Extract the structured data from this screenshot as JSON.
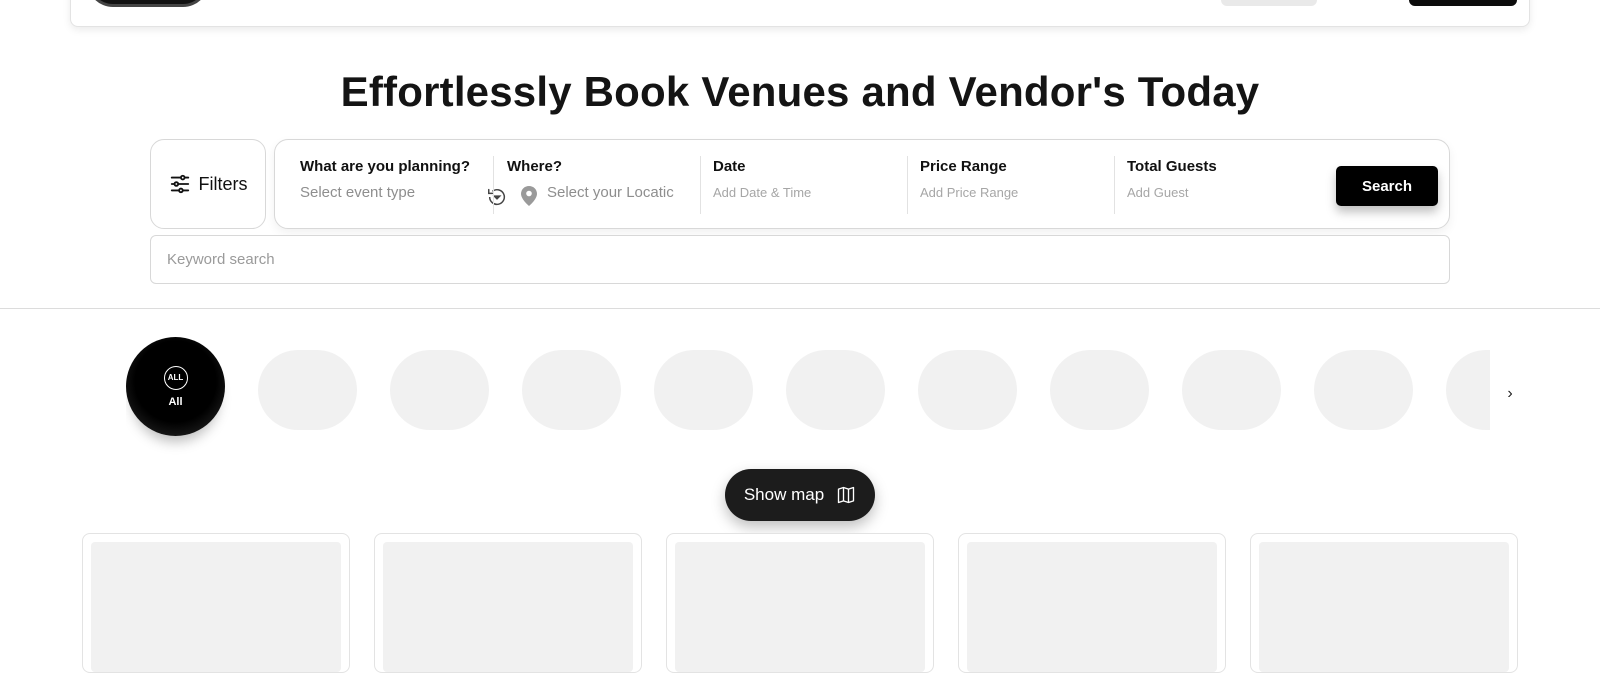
{
  "hero": {
    "title": "Effortlessly Book Venues and Vendor's Today"
  },
  "filters": {
    "label": "Filters"
  },
  "search": {
    "planning_label": "What are you planning?",
    "planning_placeholder": "Select event type",
    "where_label": "Where?",
    "where_placeholder": "Select your Locatic",
    "date_label": "Date",
    "date_placeholder": "Add Date & Time",
    "price_label": "Price Range",
    "price_placeholder": "Add Price Range",
    "guests_label": "Total Guests",
    "guests_placeholder": "Add Guest",
    "button": "Search"
  },
  "keyword": {
    "placeholder": "Keyword search"
  },
  "categories": {
    "all_badge": "ALL",
    "all_label": "All",
    "next": "›"
  },
  "map_button": {
    "label": "Show map"
  },
  "colors": {
    "accent": "#000000",
    "placeholder_bg": "#f1f1f1",
    "map_button_bg": "#1c1c1c"
  },
  "icons": {
    "filters": "sliders-icon",
    "reset": "reset-icon",
    "location": "map-pin-icon",
    "map": "map-icon",
    "next": "chevron-right-icon"
  }
}
